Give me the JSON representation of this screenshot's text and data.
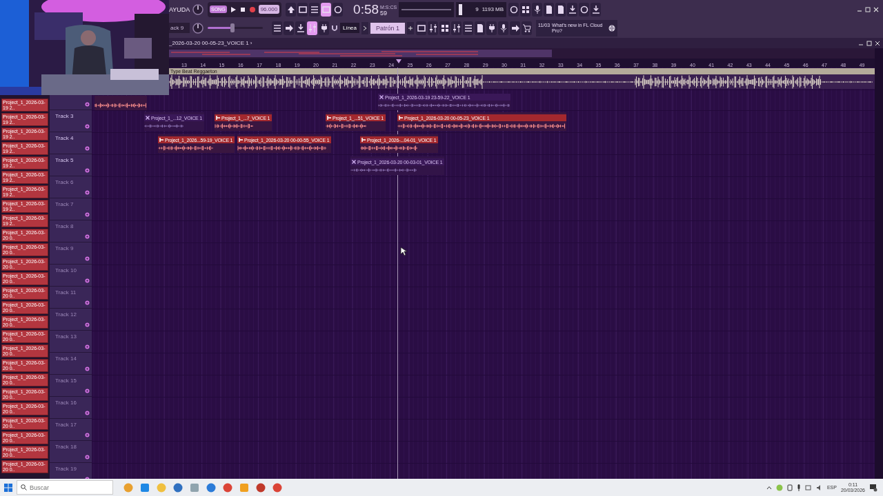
{
  "toolbar": {
    "menu": "AYUDA",
    "mode": "SONG",
    "tempo": "96.000",
    "time": "0:58",
    "time_unit": "M:S:CS",
    "time_cs": "59",
    "cpu": "9",
    "memory": "1193 MB",
    "buttons_a": [
      {
        "on": false
      },
      {
        "on": false
      },
      {
        "on": false
      },
      {
        "on": true
      },
      {
        "on": false
      }
    ],
    "buttons_d": [
      {
        "on": false
      },
      {
        "on": false
      },
      {
        "on": false
      },
      {
        "on": false
      },
      {
        "on": false
      },
      {
        "on": false
      },
      {
        "on": false
      },
      {
        "on": false
      }
    ],
    "channel": "ack 9",
    "volume": {
      "level": 0.45
    },
    "buttons_b": [
      {
        "on": false
      },
      {
        "on": false
      },
      {
        "on": false
      },
      {
        "on": true
      },
      {
        "on": false
      }
    ],
    "snap": "Línea",
    "pattern": "Patrón 1",
    "buttons_c": [
      {
        "on": false
      },
      {
        "on": false
      },
      {
        "on": false
      },
      {
        "on": false
      },
      {
        "on": false
      },
      {
        "on": false
      },
      {
        "on": false
      },
      {
        "on": false
      },
      {
        "on": false
      },
      {
        "on": false
      }
    ],
    "news": {
      "date": "11/03",
      "text": "What's new in FL Cloud Pro?"
    }
  },
  "playlist": {
    "title": "_2026-03-20 00-05-23_VOICE 1 ›",
    "ruler": [
      "13",
      "14",
      "15",
      "16",
      "17",
      "18",
      "19",
      "20",
      "21",
      "22",
      "23",
      "24",
      "25",
      "26",
      "27",
      "28",
      "29",
      "30",
      "31",
      "32",
      "33",
      "34",
      "35",
      "36",
      "37",
      "38",
      "39",
      "40",
      "41",
      "42",
      "43",
      "44",
      "45",
      "46",
      "47",
      "48",
      "49"
    ],
    "audio_track": {
      "title": "Type Beat Reggaeton"
    },
    "clip_list": [
      "Project_1_2026-03-19 2..",
      "Project_1_2026-03-19 2..",
      "Project_1_2026-03-19 2..",
      "Project_1_2026-03-19 2..",
      "Project_1_2026-03-19 2..",
      "Project_1_2026-03-19 2..",
      "Project_1_2026-03-19 2..",
      "Project_1_2026-03-19 2..",
      "Project_1_2026-03-19 2..",
      "Project_1_2026-03-20 0..",
      "Project_1_2026-03-20 0..",
      "Project_1_2026-03-20 0..",
      "Project_1_2026-03-20 0..",
      "Project_1_2026-03-20 0..",
      "Project_1_2026-03-20 0..",
      "Project_1_2026-03-20 0..",
      "Project_1_2026-03-20 0..",
      "Project_1_2026-03-20 0..",
      "Project_1_2026-03-20 0..",
      "Project_1_2026-03-20 0..",
      "Project_1_2026-03-20 0..",
      "Project_1_2026-03-20 0..",
      "Project_1_2026-03-20 0..",
      "Project_1_2026-03-20 0..",
      "Project_1_2026-03-20 0..",
      "Project_1_2026-03-20 0.."
    ],
    "tracks": [
      {
        "clips": [
          {
            "muted": false
          },
          {
            "title": "Project_1_2026-03-19 23-59-22_VOICE 1",
            "muted": true
          }
        ]
      },
      {
        "name": "Track 3",
        "active": true,
        "clips": [
          {
            "title": "Project_1_...12_VOICE 1",
            "muted": true
          },
          {
            "title": "Project_1_...7_VOICE 1",
            "muted": false
          },
          {
            "title": "Project_1_...51_VOICE 1",
            "muted": false
          },
          {
            "title": "Project_1_2026-03-20 00-05-23_VOICE 1",
            "muted": false
          }
        ]
      },
      {
        "name": "Track 4",
        "active": true,
        "clips": [
          {
            "title": "Project_1_2026...59-19_VOICE 1",
            "muted": false
          },
          {
            "title": "Project_1_2026-03-20 00-00-55_VOICE 1",
            "muted": false
          },
          {
            "title": "Project_1_2026-...04-01_VOICE 1",
            "muted": false
          }
        ]
      },
      {
        "name": "Track 5",
        "active": true,
        "clips": [
          {
            "title": "Project_1_2026-03-20 00-03-01_VOICE 1",
            "muted": true
          }
        ]
      },
      {
        "name": "Track 6",
        "active": false
      },
      {
        "name": "Track 7",
        "active": false
      },
      {
        "name": "Track 8",
        "active": false
      },
      {
        "name": "Track 9",
        "active": false
      },
      {
        "name": "Track 10",
        "active": false
      },
      {
        "name": "Track 11",
        "active": false
      },
      {
        "name": "Track 12",
        "active": false
      },
      {
        "name": "Track 13",
        "active": false
      },
      {
        "name": "Track 14",
        "active": false
      },
      {
        "name": "Track 15",
        "active": false
      },
      {
        "name": "Track 16",
        "active": false
      },
      {
        "name": "Track 17",
        "active": false
      },
      {
        "name": "Track 18",
        "active": false
      },
      {
        "name": "Track 19",
        "active": false
      }
    ]
  },
  "taskbar": {
    "search": {
      "placeholder": "Buscar"
    },
    "language": "ESP",
    "time": "0:11",
    "date": "20/03/2026"
  }
}
